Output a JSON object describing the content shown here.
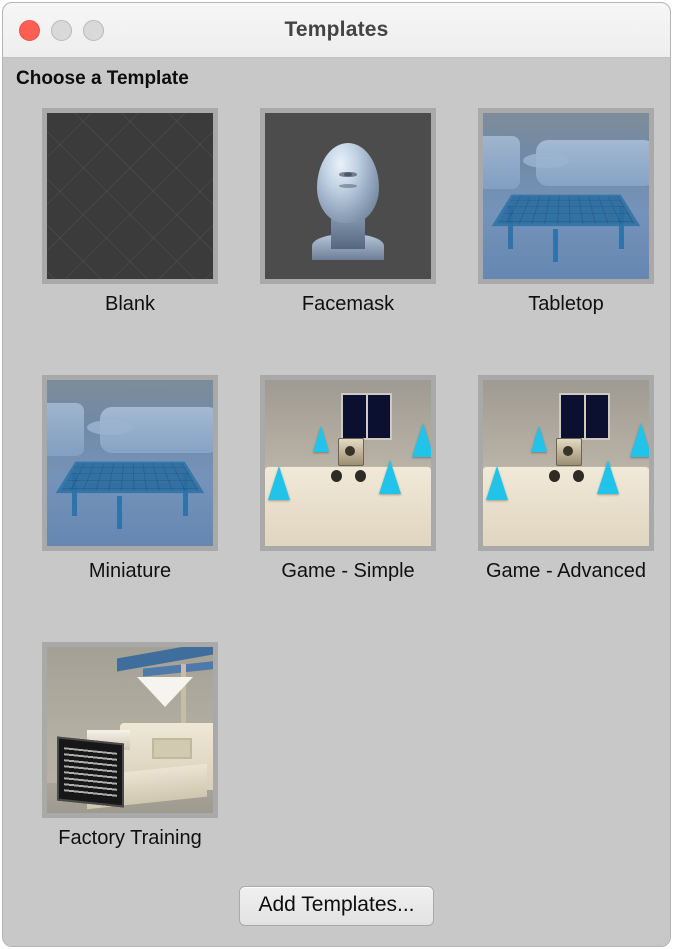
{
  "window": {
    "title": "Templates",
    "traffic_lights": [
      {
        "name": "close",
        "color": "#ff5f52"
      },
      {
        "name": "minimize",
        "color": "#d9d9d9"
      },
      {
        "name": "maximize",
        "color": "#d9d9d9"
      }
    ]
  },
  "header": {
    "section_title": "Choose a Template"
  },
  "templates": [
    {
      "label": "Blank",
      "art": "blank"
    },
    {
      "label": "Facemask",
      "art": "face"
    },
    {
      "label": "Tabletop",
      "art": "room"
    },
    {
      "label": "Miniature",
      "art": "room"
    },
    {
      "label": "Game - Simple",
      "art": "game"
    },
    {
      "label": "Game - Advanced",
      "art": "game"
    },
    {
      "label": "Factory Training",
      "art": "factory"
    }
  ],
  "footer": {
    "add_button_label": "Add Templates..."
  },
  "colors": {
    "window_background": "#c8c8c8",
    "titlebar_background": "#f2f2f2",
    "thumbnail_frame": "#a9a9a9",
    "text": "#0d0d0d",
    "title_text": "#444444"
  }
}
